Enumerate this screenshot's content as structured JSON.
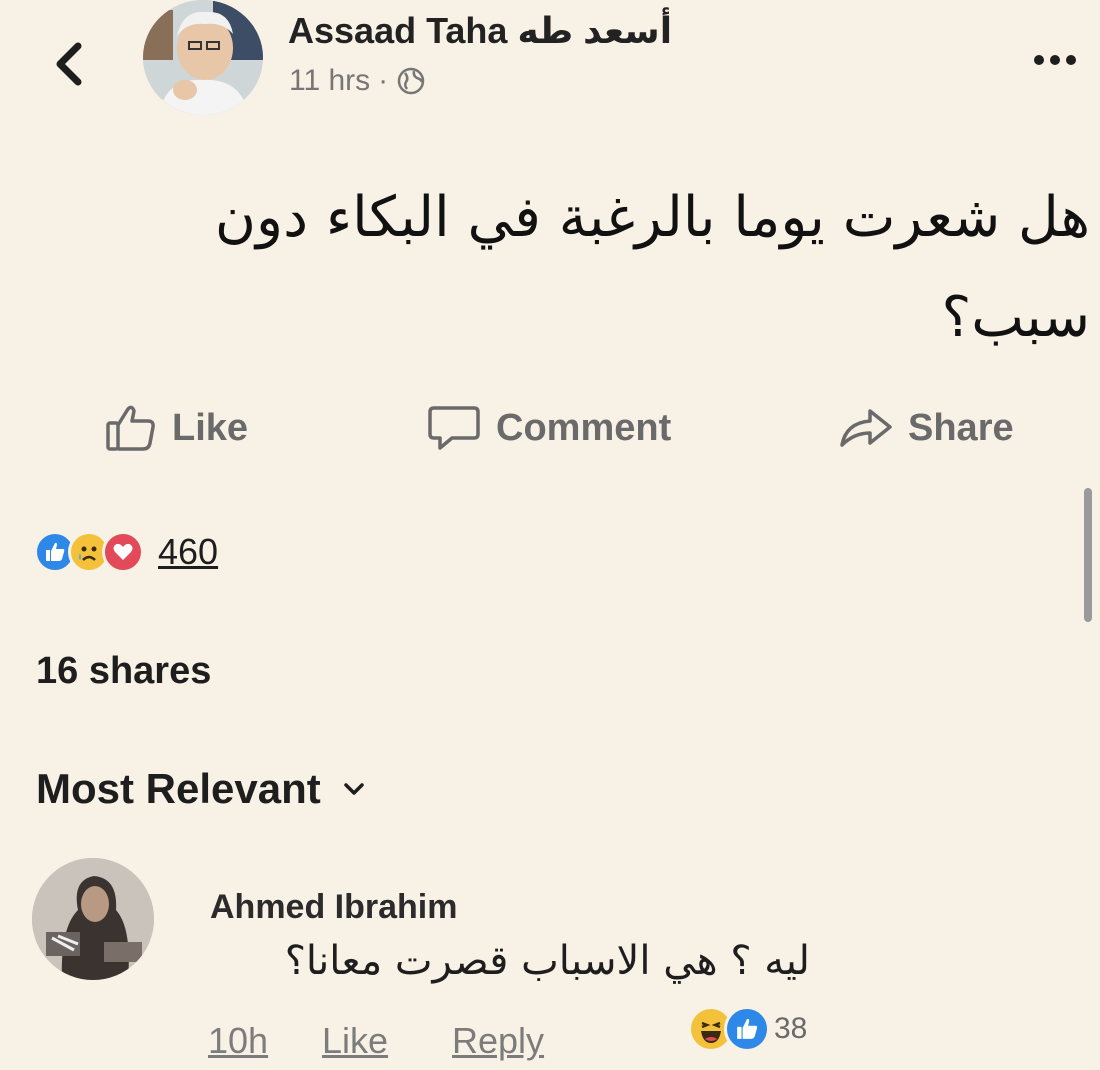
{
  "post": {
    "author": "Assaad Taha أسعد طه",
    "time": "11 hrs",
    "separator": "·",
    "privacy_icon": "globe-icon",
    "text": "هل شعرت يوما بالرغبة في البكاء دون سبب؟"
  },
  "actions": {
    "like": "Like",
    "comment": "Comment",
    "share": "Share"
  },
  "stats": {
    "reactions_count": "460",
    "reaction_icons": [
      "like-icon",
      "sad-icon",
      "love-icon"
    ],
    "shares": "16 shares"
  },
  "comments_section": {
    "sort_label": "Most Relevant"
  },
  "comment": {
    "author": "Ahmed Ibrahim",
    "text": "ليه ؟ هي الاسباب قصرت معانا؟",
    "time": "10h",
    "like": "Like",
    "reply": "Reply",
    "reaction_icons": [
      "haha-icon",
      "like-icon"
    ],
    "reactions_count": "38"
  },
  "colors": {
    "background": "#f8f1e6",
    "like_blue": "#2d88e8",
    "love_red": "#e24a5a",
    "emoji_yellow": "#f4c13a",
    "muted_text": "#767676"
  }
}
